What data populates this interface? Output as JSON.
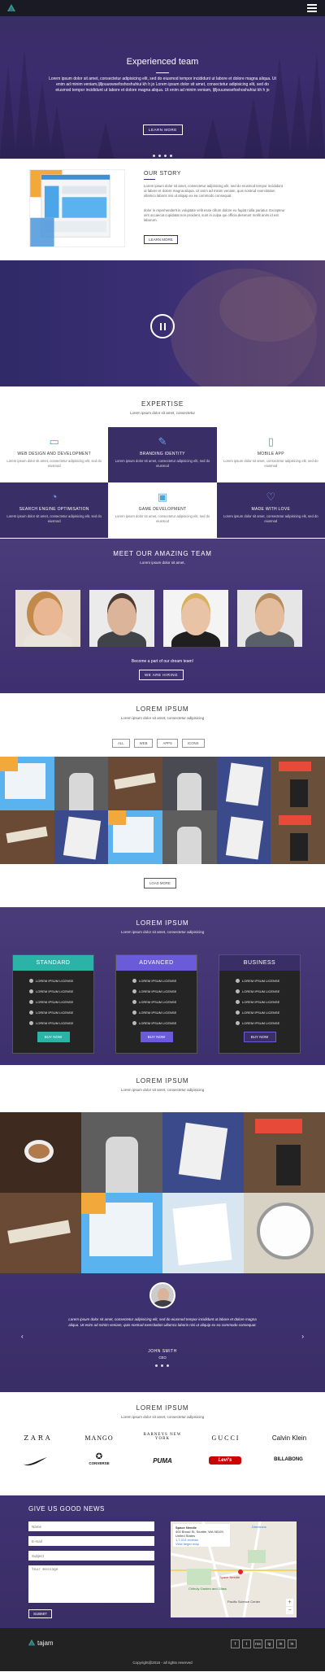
{
  "colors": {
    "primary": "#3a2e66",
    "accent_blue": "#4aa6d8",
    "standard": "#2bb3a8",
    "advanced": "#6a5cd8",
    "business": "#3a2e66"
  },
  "hero": {
    "title": "Experienced team",
    "text": "Lorem ipsum dolor sit amet, consectetur adipisicing elit, sed do eiusmod tempor incididunt ut labore et dolore magna aliqua. Ut enim ad minim veniam,ljlljouuowsefoshoshuhiui kh h jo Lorem ipsum dolor sit amet, consectetur adipisicing elit, sed do eiusmod tempor incididunt ut labore et dolore magna aliqua. Ut enim ad minim veniam, ljlljouuowsefoshoshuhiui kh h jo",
    "button": "LEARN MORE"
  },
  "story": {
    "title": "OUR STORY",
    "p1": "Lorem ipsum dolor sit amet, consectetur adipisicing elit, sed do eiusmod tempor incididunt ut labore et dolore magna aliqua. Ut enim ad minim veniam, quis nostrud exercitation ullamco laboris nisi ut aliquip ex ea commodo consequat.",
    "p2": "dolor in reprehenderit in voluptate velit esse cillum dolore eu fugiat nulla pariatur. Excepteur sint occaecat cupidatat non proident, sunt in culpa qui officia deserunt mollit anim id est laborum.",
    "button": "LEARN MORE"
  },
  "expertise": {
    "title": "EXPERTISE",
    "subtitle": "Lorem ipsum dolor sit amet, consectetur",
    "items": [
      {
        "title": "WEB DESIGN AND DEVELOPMENT",
        "desc": "Lorem ipsum dolor sit amet, consectetur adipisicing elit, sed do eiusmod",
        "icon": "monitor-icon"
      },
      {
        "title": "BRANDING IDENTITY",
        "desc": "Lorem ipsum dolor sit amet, consectetur adipisicing elit, sed do eiusmod",
        "icon": "pen-icon"
      },
      {
        "title": "MOBILE APP",
        "desc": "Lorem ipsum dolor sit amet, consectetur adipisicing elit, sed do eiusmod",
        "icon": "phone-icon"
      },
      {
        "title": "SEARCH ENGINE OPTIMISATION",
        "desc": "Lorem ipsum dolor sit amet, consectetur adipisicing elit, sed do eiusmod",
        "icon": "pie-icon"
      },
      {
        "title": "GAME DEVELOPMENT",
        "desc": "Lorem ipsum dolor sit amet, consectetur adipisicing elit, sed do eiusmod",
        "icon": "gamepad-icon"
      },
      {
        "title": "MADE WITH LOVE",
        "desc": "Lorem ipsum dolor sit amet, consectetur adipisicing elit, sed do eiusmod",
        "icon": "heart-icon"
      }
    ]
  },
  "team": {
    "title": "MEET OUR AMAZING TEAM",
    "subtitle": "Lorem ipsum dolor sit amet,",
    "join": "Become a part of our dream team!",
    "button": "WE ARE HIRING"
  },
  "portfolio": {
    "title": "LOREM IPSUM",
    "subtitle": "Lorem ipsum dolor sit amet, consectetur adipisicing",
    "filters": [
      "ALL",
      "WEB",
      "APPS",
      "ICONS"
    ],
    "button": "LOAD MORE"
  },
  "pricing": {
    "title": "LOREM IPSUM",
    "subtitle": "Lorem ipsum dolor sit amet, consectetur adipisicing",
    "feature": "LOREM IPSUM LICENSE",
    "plans": [
      {
        "name": "STANDARD",
        "button": "BUY NOW"
      },
      {
        "name": "ADVANCED",
        "button": "BUY NOW"
      },
      {
        "name": "BUSINESS",
        "button": "BUY NOW"
      }
    ]
  },
  "gallery": {
    "title": "LOREM IPSUM",
    "subtitle": "Lorem ipsum dolor sit amet, consectetur adipisicing"
  },
  "testimonial": {
    "quote": "Lorem ipsum dolor sit amet, consectetur adipisicing elit, sed do eiusmod tempor incididunt ut labore et dolore magna aliqua. Ut enim ad minim veniam, quis nostrud exercitation ullamco laboris nisi ut aliquip ex ea commodo consequat.",
    "name": "JOHN SMITH",
    "role": "CEO"
  },
  "brands": {
    "title": "LOREM IPSUM",
    "subtitle": "Lorem ipsum dolor sit amet, consectetur adipisicing",
    "row1": [
      "ZARA",
      "MANGO",
      "BARNEYS NEW YORK",
      "GUCCI",
      "Calvin Klein"
    ],
    "row2": [
      "nike",
      "CONVERSE",
      "PUMA",
      "Levi's",
      "BILLABONG"
    ]
  },
  "contact": {
    "title": "GIVE US GOOD NEWS",
    "name_ph": "Name",
    "email_ph": "E-mail",
    "subject_ph": "Subject",
    "message_ph": "Your message",
    "submit": "SUBMIT",
    "map_place": "Space Needle",
    "map_address": "400 Broad St, Seattle, WA 98109, United States",
    "map_directions": "Directions",
    "map_reviews": "1,7,014 reviews",
    "map_larger": "View larger map",
    "map_label1": "Space Needle",
    "map_label2": "Chihuly Garden and Glass",
    "map_label3": "Pacific Science Center"
  },
  "footer": {
    "brand": "tajam",
    "socials": [
      "f",
      "t",
      "rss",
      "ig",
      "in",
      "in"
    ],
    "copyright": "Copyright@2016 - all rights reserved"
  }
}
